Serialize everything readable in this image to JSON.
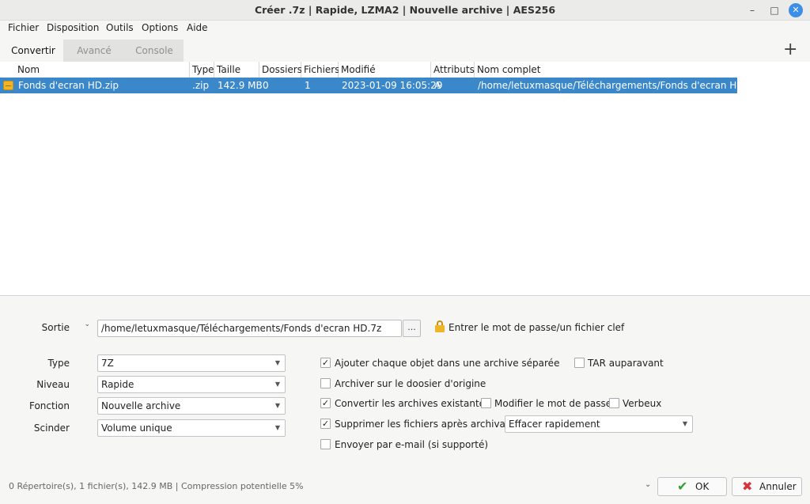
{
  "window": {
    "title": "Créer .7z | Rapide, LZMA2 | Nouvelle archive | AES256",
    "minimize_glyph": "–",
    "maximize_glyph": "□",
    "close_glyph": "✕"
  },
  "menu": [
    "Fichier",
    "Disposition",
    "Outils",
    "Options",
    "Aide"
  ],
  "tabs": [
    "Convertir",
    "Avancé",
    "Console"
  ],
  "add_button_glyph": "+",
  "table": {
    "columns": [
      "Nom",
      "Type",
      "Taille",
      "Dossiers",
      "Fichiers",
      "Modifié",
      "Attributs",
      "Nom complet"
    ],
    "rows": [
      {
        "name": "Fonds d'ecran HD.zip",
        "type": ".zip",
        "size": "142.9 MB",
        "folders": "0",
        "files": "1",
        "modified": "2023-01-09 16:05:29",
        "attributes": "A",
        "full_name": "/home/letuxmasque/Téléchargements/Fonds d'ecran HD.zip"
      }
    ]
  },
  "output": {
    "label": "Sortie",
    "path": "/home/letuxmasque/Téléchargements/Fonds d'ecran HD.7z",
    "browse_label": "...",
    "password_link": "Entrer le mot de passe/un fichier clef"
  },
  "settings": {
    "type_label": "Type",
    "type_value": "7Z",
    "level_label": "Niveau",
    "level_value": "Rapide",
    "function_label": "Fonction",
    "function_value": "Nouvelle archive",
    "split_label": "Scinder",
    "split_value": "Volume unique"
  },
  "options": {
    "separate": {
      "label": "Ajouter chaque objet dans une archive séparée",
      "checked": true
    },
    "tar_first": {
      "label": "TAR auparavant",
      "checked": false
    },
    "archive_origin": {
      "label": "Archiver sur le doosier d'origine",
      "checked": false
    },
    "convert_existing": {
      "label": "Convertir les archives existantes",
      "checked": true
    },
    "change_password": {
      "label": "Modifier le mot de passe",
      "checked": false
    },
    "verbose": {
      "label": "Verbeux",
      "checked": false
    },
    "delete_after": {
      "label": "Supprimer les fichiers après archivage",
      "checked": true
    },
    "delete_mode": "Effacer rapidement",
    "email": {
      "label": "Envoyer par e-mail (si supporté)",
      "checked": false
    }
  },
  "check_glyph": "✓",
  "status_text": "0 Répertoire(s), 1 fichier(s), 142.9 MB | Compression potentielle 5%",
  "buttons": {
    "ok": "OK",
    "cancel": "Annuler"
  },
  "colors": {
    "selection": "#3a87c9",
    "ok_check": "#2fa12f",
    "cancel_x": "#d8323c",
    "close_button": "#3d8ee6"
  }
}
